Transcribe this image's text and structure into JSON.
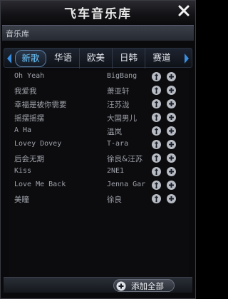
{
  "window": {
    "title": "飞车音乐库"
  },
  "subbar": {
    "label": "音乐库"
  },
  "tabs": [
    {
      "label": "新歌",
      "active": true
    },
    {
      "label": "华语",
      "active": false
    },
    {
      "label": "欧美",
      "active": false
    },
    {
      "label": "日韩",
      "active": false
    },
    {
      "label": "赛道",
      "active": false
    }
  ],
  "songs": [
    {
      "title": "Oh Yeah",
      "artist": "BigBang"
    },
    {
      "title": "我爱我",
      "artist": "萧亚轩"
    },
    {
      "title": "幸福是被你需要",
      "artist": "汪苏泷"
    },
    {
      "title": "摇摆摇摆",
      "artist": "大国男儿"
    },
    {
      "title": "A Ha",
      "artist": "温岚"
    },
    {
      "title": "Lovey Dovey",
      "artist": "T-ara"
    },
    {
      "title": "后会无期",
      "artist": "徐良&汪苏"
    },
    {
      "title": "Kiss",
      "artist": "2NE1"
    },
    {
      "title": "Love Me Back",
      "artist": "Jenna Gar"
    },
    {
      "title": "美瞳",
      "artist": "徐良"
    }
  ],
  "footer": {
    "add_all_label": "添加全部"
  },
  "icons": {
    "close": "close-icon",
    "tab_prev": "chevron-left-icon",
    "tab_next": "chevron-right-icon",
    "play": "play-icon",
    "add": "plus-icon",
    "add_all": "plus-icon"
  },
  "colors": {
    "active_tab": "#6ec8ff",
    "text": "#9ea2aa",
    "background": "#0a0a0c"
  }
}
